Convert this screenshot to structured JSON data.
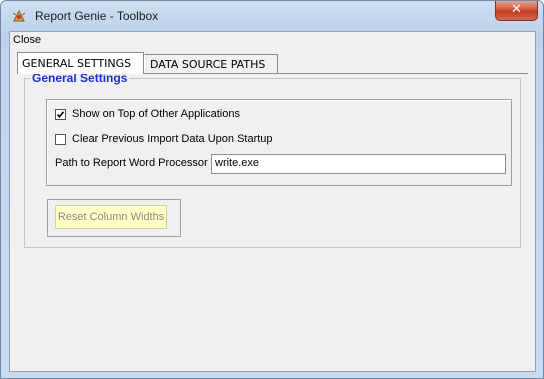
{
  "window": {
    "title": "Report Genie - Toolbox",
    "close_glyph": "✕",
    "icon_name": "report-genie-app-icon"
  },
  "menu": {
    "close_label": "Close"
  },
  "tabs": [
    {
      "label": "GENERAL SETTINGS",
      "selected": true
    },
    {
      "label": "DATA SOURCE PATHS",
      "selected": false
    }
  ],
  "general_settings": {
    "group_title": "General Settings",
    "show_on_top": {
      "label": "Show on Top of Other Applications",
      "checked": true
    },
    "clear_previous": {
      "label": "Clear Previous Import Data Upon Startup",
      "checked": false
    },
    "path_label": "Path to Report Word Processor",
    "path_value": "write.exe",
    "reset_button_label": "Reset Column Widths"
  },
  "colors": {
    "group_title": "#1f2ed0",
    "reset_button_bg": "#ffffc6",
    "close_button": "#c13b20"
  }
}
